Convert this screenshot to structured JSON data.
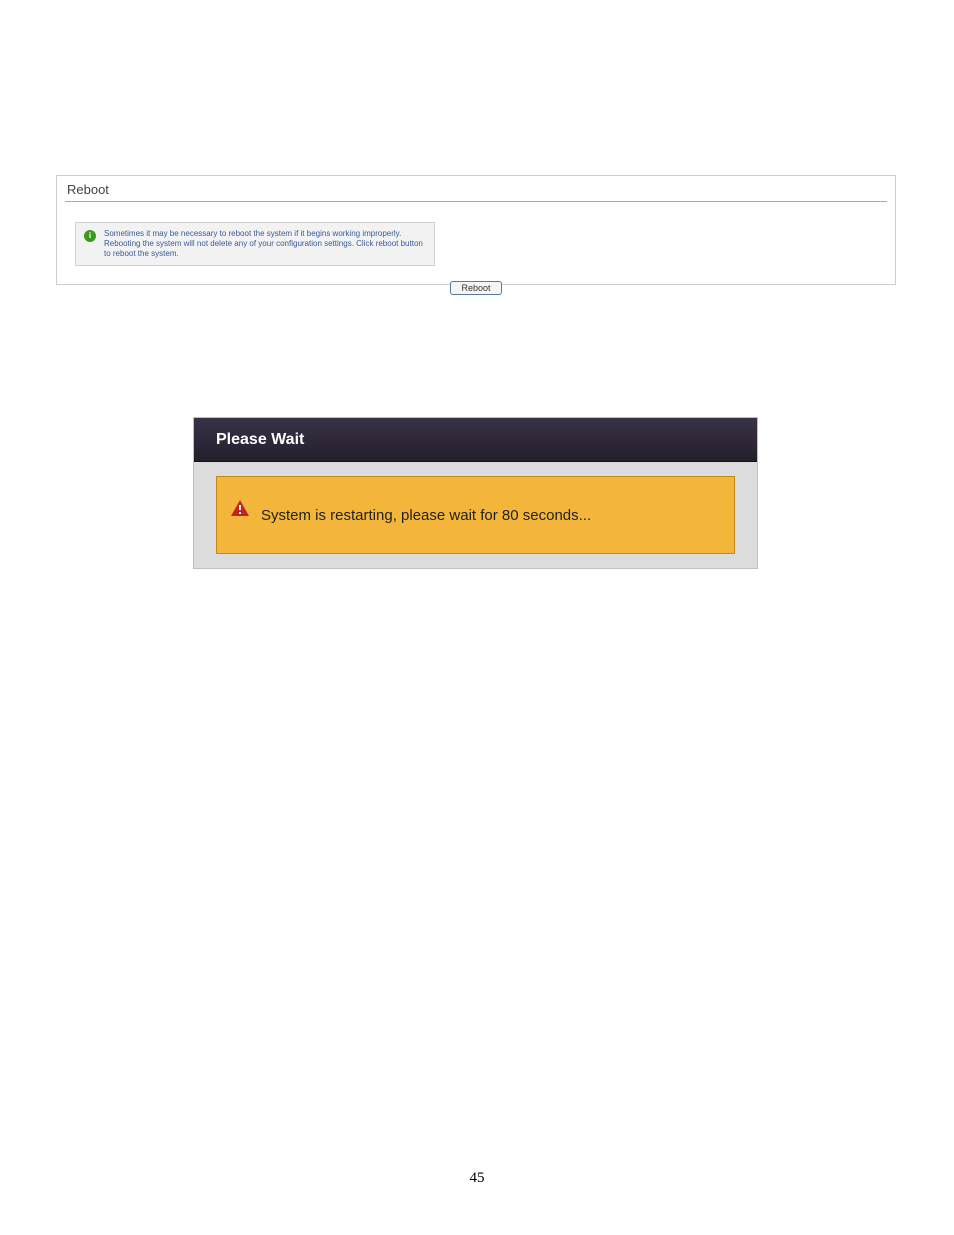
{
  "reboot_panel": {
    "title": "Reboot",
    "info_message": "Sometimes it may be necessary to reboot the system if it begins working improperly. Rebooting the system will not delete any of your configuration settings. Click reboot button to reboot the system.",
    "button_label": "Reboot"
  },
  "wait_dialog": {
    "title": "Please Wait",
    "message": "System is restarting, please wait for 80 seconds..."
  },
  "page_number": "45"
}
